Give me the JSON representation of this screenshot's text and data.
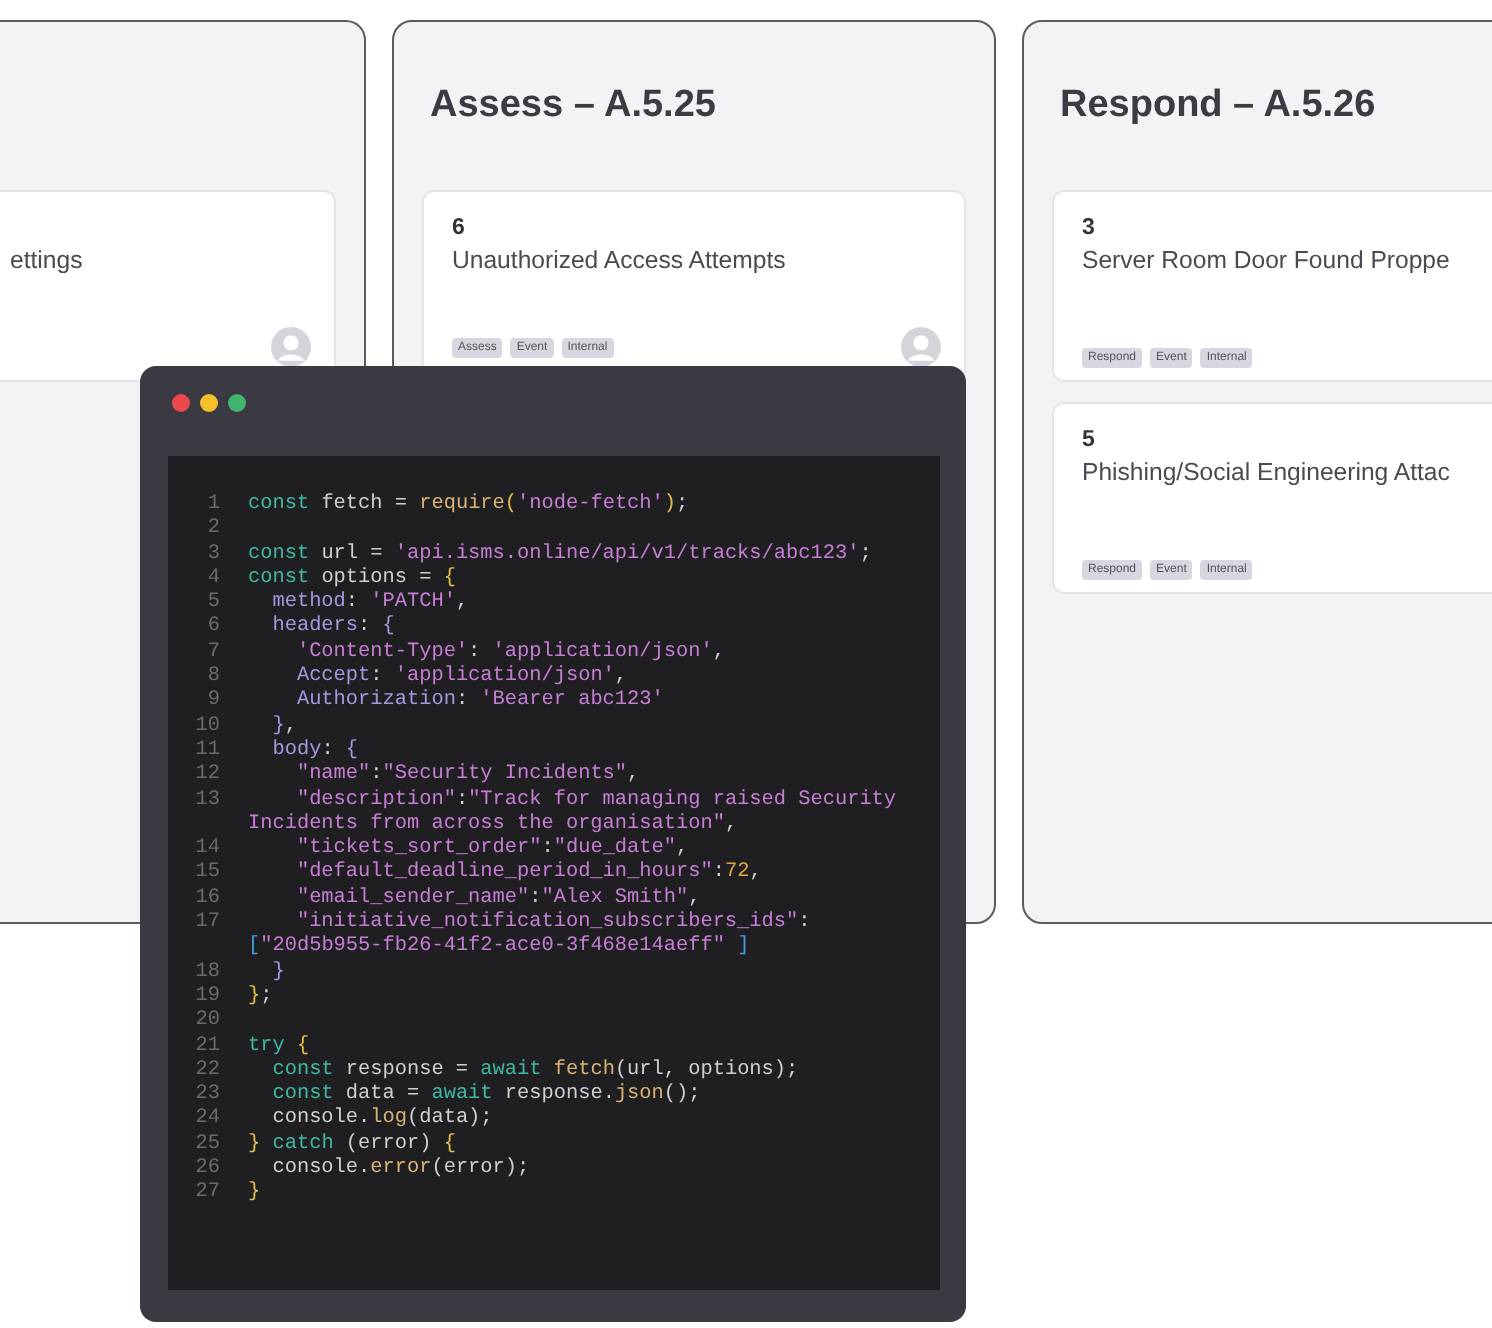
{
  "columns": [
    {
      "cards": [
        {
          "title": "ettings",
          "has_avatar": true
        }
      ]
    },
    {
      "title": "Assess – A.5.25",
      "cards": [
        {
          "number": "6",
          "title": "Unauthorized Access Attempts",
          "tags": [
            "Assess",
            "Event",
            "Internal"
          ],
          "has_avatar": true
        }
      ]
    },
    {
      "title": "Respond – A.5.26",
      "cards": [
        {
          "number": "3",
          "title": "Server Room Door Found Proppe",
          "tags": [
            "Respond",
            "Event",
            "Internal"
          ],
          "has_avatar": false
        },
        {
          "number": "5",
          "title": "Phishing/Social Engineering Attac",
          "tags": [
            "Respond",
            "Event",
            "Internal"
          ],
          "has_avatar": false
        }
      ]
    }
  ],
  "code_window": {
    "lines": [
      {
        "number": "1",
        "tokens": [
          {
            "kind": "kw",
            "text": "const"
          },
          {
            "kind": "id",
            "text": " fetch = "
          },
          {
            "kind": "fn",
            "text": "require"
          },
          {
            "kind": "brace",
            "text": "("
          },
          {
            "kind": "str",
            "text": "'node-fetch'"
          },
          {
            "kind": "brace",
            "text": ")"
          },
          {
            "kind": "id",
            "text": ";"
          }
        ]
      },
      {
        "number": "2"
      },
      {
        "number": "3",
        "tokens": [
          {
            "kind": "kw",
            "text": "const"
          },
          {
            "kind": "id",
            "text": " url = "
          },
          {
            "kind": "str",
            "text": "'api.isms.online/api/v1/tracks/abc123'"
          },
          {
            "kind": "id",
            "text": ";"
          }
        ]
      },
      {
        "number": "4",
        "tokens": [
          {
            "kind": "kw",
            "text": "const"
          },
          {
            "kind": "id",
            "text": " options = "
          },
          {
            "kind": "brace",
            "text": "{"
          }
        ]
      },
      {
        "number": "5",
        "tokens": [
          {
            "kind": "prop",
            "text": "  method"
          },
          {
            "kind": "id",
            "text": ": "
          },
          {
            "kind": "str",
            "text": "'PATCH'"
          },
          {
            "kind": "id",
            "text": ","
          }
        ]
      },
      {
        "number": "6",
        "tokens": [
          {
            "kind": "prop",
            "text": "  headers"
          },
          {
            "kind": "id",
            "text": ": "
          },
          {
            "kind": "prop",
            "text": "{"
          }
        ]
      },
      {
        "number": "7",
        "tokens": [
          {
            "kind": "str",
            "text": "    'Content-Type'"
          },
          {
            "kind": "id",
            "text": ": "
          },
          {
            "kind": "str",
            "text": "'application/json'"
          },
          {
            "kind": "id",
            "text": ","
          }
        ]
      },
      {
        "number": "8",
        "tokens": [
          {
            "kind": "prop",
            "text": "    Accept"
          },
          {
            "kind": "id",
            "text": ": "
          },
          {
            "kind": "str",
            "text": "'application/json'"
          },
          {
            "kind": "id",
            "text": ","
          }
        ]
      },
      {
        "number": "9",
        "tokens": [
          {
            "kind": "prop",
            "text": "    Authorization"
          },
          {
            "kind": "id",
            "text": ": "
          },
          {
            "kind": "str",
            "text": "'Bearer abc123'"
          }
        ]
      },
      {
        "number": "10",
        "tokens": [
          {
            "kind": "prop",
            "text": "  }"
          },
          {
            "kind": "id",
            "text": ","
          }
        ]
      },
      {
        "number": "11",
        "tokens": [
          {
            "kind": "prop",
            "text": "  body"
          },
          {
            "kind": "id",
            "text": ": "
          },
          {
            "kind": "prop",
            "text": "{"
          }
        ]
      },
      {
        "number": "12",
        "tokens": [
          {
            "kind": "str",
            "text": "    \"name\""
          },
          {
            "kind": "id",
            "text": ":"
          },
          {
            "kind": "str",
            "text": "\"Security Incidents\""
          },
          {
            "kind": "id",
            "text": ","
          }
        ]
      },
      {
        "number": "13",
        "tokens": [
          {
            "kind": "str",
            "text": "    \"description\""
          },
          {
            "kind": "id",
            "text": ":"
          },
          {
            "kind": "str",
            "text": "\"Track for managing raised Security"
          }
        ],
        "continuation": [
          {
            "kind": "str",
            "text": "Incidents from across the organisation\""
          },
          {
            "kind": "id",
            "text": ","
          }
        ]
      },
      {
        "number": "14",
        "tokens": [
          {
            "kind": "str",
            "text": "    \"tickets_sort_order\""
          },
          {
            "kind": "id",
            "text": ":"
          },
          {
            "kind": "str",
            "text": "\"due_date\""
          },
          {
            "kind": "id",
            "text": ","
          }
        ]
      },
      {
        "number": "15",
        "tokens": [
          {
            "kind": "str",
            "text": "    \"default_deadline_period_in_hours\""
          },
          {
            "kind": "id",
            "text": ":"
          },
          {
            "kind": "num",
            "text": "72"
          },
          {
            "kind": "id",
            "text": ","
          }
        ]
      },
      {
        "number": "16",
        "tokens": [
          {
            "kind": "str",
            "text": "    \"email_sender_name\""
          },
          {
            "kind": "id",
            "text": ":"
          },
          {
            "kind": "str",
            "text": "\"Alex Smith\""
          },
          {
            "kind": "id",
            "text": ","
          }
        ]
      },
      {
        "number": "17",
        "tokens": [
          {
            "kind": "str",
            "text": "    \"initiative_notification_subscribers_ids\""
          },
          {
            "kind": "id",
            "text": ":"
          }
        ],
        "continuation": [
          {
            "kind": "bracket",
            "text": "["
          },
          {
            "kind": "str",
            "text": "\"20d5b955-fb26-41f2-ace0-3f468e14aeff\""
          },
          {
            "kind": "bracket",
            "text": " ]"
          }
        ]
      },
      {
        "number": "18",
        "tokens": [
          {
            "kind": "prop",
            "text": "  }"
          }
        ]
      },
      {
        "number": "19",
        "tokens": [
          {
            "kind": "brace",
            "text": "}"
          },
          {
            "kind": "id",
            "text": ";"
          }
        ]
      },
      {
        "number": "20"
      },
      {
        "number": "21",
        "tokens": [
          {
            "kind": "kw",
            "text": "try"
          },
          {
            "kind": "brace",
            "text": " {"
          }
        ]
      },
      {
        "number": "22",
        "tokens": [
          {
            "kind": "kw",
            "text": "  const"
          },
          {
            "kind": "id",
            "text": " response = "
          },
          {
            "kind": "kw",
            "text": "await"
          },
          {
            "kind": "fn",
            "text": " fetch"
          },
          {
            "kind": "id",
            "text": "(url, options);"
          }
        ]
      },
      {
        "number": "23",
        "tokens": [
          {
            "kind": "kw",
            "text": "  const"
          },
          {
            "kind": "id",
            "text": " data = "
          },
          {
            "kind": "kw",
            "text": "await"
          },
          {
            "kind": "id",
            "text": " response."
          },
          {
            "kind": "fn",
            "text": "json"
          },
          {
            "kind": "id",
            "text": "();"
          }
        ]
      },
      {
        "number": "24",
        "tokens": [
          {
            "kind": "id",
            "text": "  console."
          },
          {
            "kind": "fn",
            "text": "log"
          },
          {
            "kind": "id",
            "text": "(data);"
          }
        ]
      },
      {
        "number": "25",
        "tokens": [
          {
            "kind": "brace",
            "text": "}"
          },
          {
            "kind": "kw",
            "text": " catch"
          },
          {
            "kind": "id",
            "text": " (error) "
          },
          {
            "kind": "brace",
            "text": "{"
          }
        ]
      },
      {
        "number": "26",
        "tokens": [
          {
            "kind": "id",
            "text": "  console."
          },
          {
            "kind": "fn",
            "text": "error"
          },
          {
            "kind": "id",
            "text": "(error);"
          }
        ]
      },
      {
        "number": "27",
        "tokens": [
          {
            "kind": "brace",
            "text": "}"
          }
        ]
      }
    ]
  }
}
